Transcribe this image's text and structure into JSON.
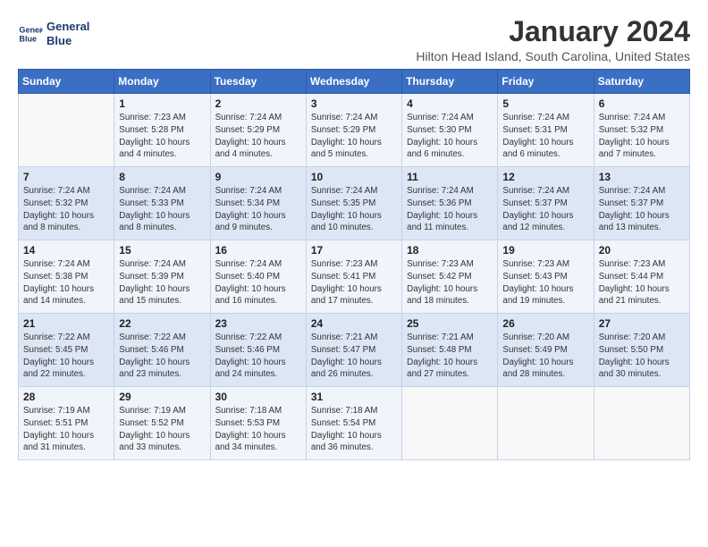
{
  "header": {
    "logo_line1": "General",
    "logo_line2": "Blue",
    "title": "January 2024",
    "subtitle": "Hilton Head Island, South Carolina, United States"
  },
  "weekdays": [
    "Sunday",
    "Monday",
    "Tuesday",
    "Wednesday",
    "Thursday",
    "Friday",
    "Saturday"
  ],
  "weeks": [
    [
      {
        "day": "",
        "info": ""
      },
      {
        "day": "1",
        "info": "Sunrise: 7:23 AM\nSunset: 5:28 PM\nDaylight: 10 hours\nand 4 minutes."
      },
      {
        "day": "2",
        "info": "Sunrise: 7:24 AM\nSunset: 5:29 PM\nDaylight: 10 hours\nand 4 minutes."
      },
      {
        "day": "3",
        "info": "Sunrise: 7:24 AM\nSunset: 5:29 PM\nDaylight: 10 hours\nand 5 minutes."
      },
      {
        "day": "4",
        "info": "Sunrise: 7:24 AM\nSunset: 5:30 PM\nDaylight: 10 hours\nand 6 minutes."
      },
      {
        "day": "5",
        "info": "Sunrise: 7:24 AM\nSunset: 5:31 PM\nDaylight: 10 hours\nand 6 minutes."
      },
      {
        "day": "6",
        "info": "Sunrise: 7:24 AM\nSunset: 5:32 PM\nDaylight: 10 hours\nand 7 minutes."
      }
    ],
    [
      {
        "day": "7",
        "info": "Sunrise: 7:24 AM\nSunset: 5:32 PM\nDaylight: 10 hours\nand 8 minutes."
      },
      {
        "day": "8",
        "info": "Sunrise: 7:24 AM\nSunset: 5:33 PM\nDaylight: 10 hours\nand 8 minutes."
      },
      {
        "day": "9",
        "info": "Sunrise: 7:24 AM\nSunset: 5:34 PM\nDaylight: 10 hours\nand 9 minutes."
      },
      {
        "day": "10",
        "info": "Sunrise: 7:24 AM\nSunset: 5:35 PM\nDaylight: 10 hours\nand 10 minutes."
      },
      {
        "day": "11",
        "info": "Sunrise: 7:24 AM\nSunset: 5:36 PM\nDaylight: 10 hours\nand 11 minutes."
      },
      {
        "day": "12",
        "info": "Sunrise: 7:24 AM\nSunset: 5:37 PM\nDaylight: 10 hours\nand 12 minutes."
      },
      {
        "day": "13",
        "info": "Sunrise: 7:24 AM\nSunset: 5:37 PM\nDaylight: 10 hours\nand 13 minutes."
      }
    ],
    [
      {
        "day": "14",
        "info": "Sunrise: 7:24 AM\nSunset: 5:38 PM\nDaylight: 10 hours\nand 14 minutes."
      },
      {
        "day": "15",
        "info": "Sunrise: 7:24 AM\nSunset: 5:39 PM\nDaylight: 10 hours\nand 15 minutes."
      },
      {
        "day": "16",
        "info": "Sunrise: 7:24 AM\nSunset: 5:40 PM\nDaylight: 10 hours\nand 16 minutes."
      },
      {
        "day": "17",
        "info": "Sunrise: 7:23 AM\nSunset: 5:41 PM\nDaylight: 10 hours\nand 17 minutes."
      },
      {
        "day": "18",
        "info": "Sunrise: 7:23 AM\nSunset: 5:42 PM\nDaylight: 10 hours\nand 18 minutes."
      },
      {
        "day": "19",
        "info": "Sunrise: 7:23 AM\nSunset: 5:43 PM\nDaylight: 10 hours\nand 19 minutes."
      },
      {
        "day": "20",
        "info": "Sunrise: 7:23 AM\nSunset: 5:44 PM\nDaylight: 10 hours\nand 21 minutes."
      }
    ],
    [
      {
        "day": "21",
        "info": "Sunrise: 7:22 AM\nSunset: 5:45 PM\nDaylight: 10 hours\nand 22 minutes."
      },
      {
        "day": "22",
        "info": "Sunrise: 7:22 AM\nSunset: 5:46 PM\nDaylight: 10 hours\nand 23 minutes."
      },
      {
        "day": "23",
        "info": "Sunrise: 7:22 AM\nSunset: 5:46 PM\nDaylight: 10 hours\nand 24 minutes."
      },
      {
        "day": "24",
        "info": "Sunrise: 7:21 AM\nSunset: 5:47 PM\nDaylight: 10 hours\nand 26 minutes."
      },
      {
        "day": "25",
        "info": "Sunrise: 7:21 AM\nSunset: 5:48 PM\nDaylight: 10 hours\nand 27 minutes."
      },
      {
        "day": "26",
        "info": "Sunrise: 7:20 AM\nSunset: 5:49 PM\nDaylight: 10 hours\nand 28 minutes."
      },
      {
        "day": "27",
        "info": "Sunrise: 7:20 AM\nSunset: 5:50 PM\nDaylight: 10 hours\nand 30 minutes."
      }
    ],
    [
      {
        "day": "28",
        "info": "Sunrise: 7:19 AM\nSunset: 5:51 PM\nDaylight: 10 hours\nand 31 minutes."
      },
      {
        "day": "29",
        "info": "Sunrise: 7:19 AM\nSunset: 5:52 PM\nDaylight: 10 hours\nand 33 minutes."
      },
      {
        "day": "30",
        "info": "Sunrise: 7:18 AM\nSunset: 5:53 PM\nDaylight: 10 hours\nand 34 minutes."
      },
      {
        "day": "31",
        "info": "Sunrise: 7:18 AM\nSunset: 5:54 PM\nDaylight: 10 hours\nand 36 minutes."
      },
      {
        "day": "",
        "info": ""
      },
      {
        "day": "",
        "info": ""
      },
      {
        "day": "",
        "info": ""
      }
    ]
  ]
}
